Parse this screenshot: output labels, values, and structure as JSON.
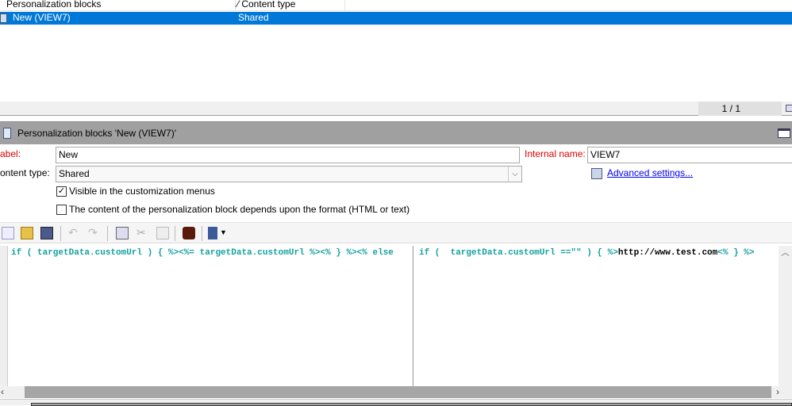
{
  "list": {
    "columns": [
      "Personalization blocks",
      "Content type"
    ],
    "rows": [
      {
        "name": "New (VIEW7)",
        "type": "Shared",
        "selected": true
      }
    ],
    "pager": "1 / 1"
  },
  "panel": {
    "title": "Personalization blocks 'New (VIEW7)'"
  },
  "form": {
    "label_label": "abel:",
    "label_value": "New",
    "internal_label": "Internal name:",
    "internal_value": "VIEW7",
    "content_type_label": "ontent type:",
    "content_type_value": "Shared",
    "advanced_link": "Advanced settings...",
    "checkbox1": {
      "label": "Visible in the customization menus",
      "checked": true
    },
    "checkbox2": {
      "label": "The content of the personalization block depends upon the format (HTML or text)",
      "checked": false
    }
  },
  "toolbar": {
    "icons": [
      "new-icon",
      "open-icon",
      "save-icon",
      "undo-icon",
      "redo-icon",
      "copy-icon",
      "cut-icon",
      "paste-icon",
      "find-icon",
      "insert-icon"
    ]
  },
  "editor": {
    "left_code": "if ( targetData.customUrl ) { %><%= targetData.customUrl %><% } %><% else",
    "right_code_1": "if (  targetData.customUrl ==\"\" ) { %>",
    "right_url": "http://www.test.com",
    "right_code_2": "<% } %>"
  },
  "colors": {
    "selection": "#0078d7",
    "code": "#13a0a0",
    "required_label": "#e00000"
  }
}
